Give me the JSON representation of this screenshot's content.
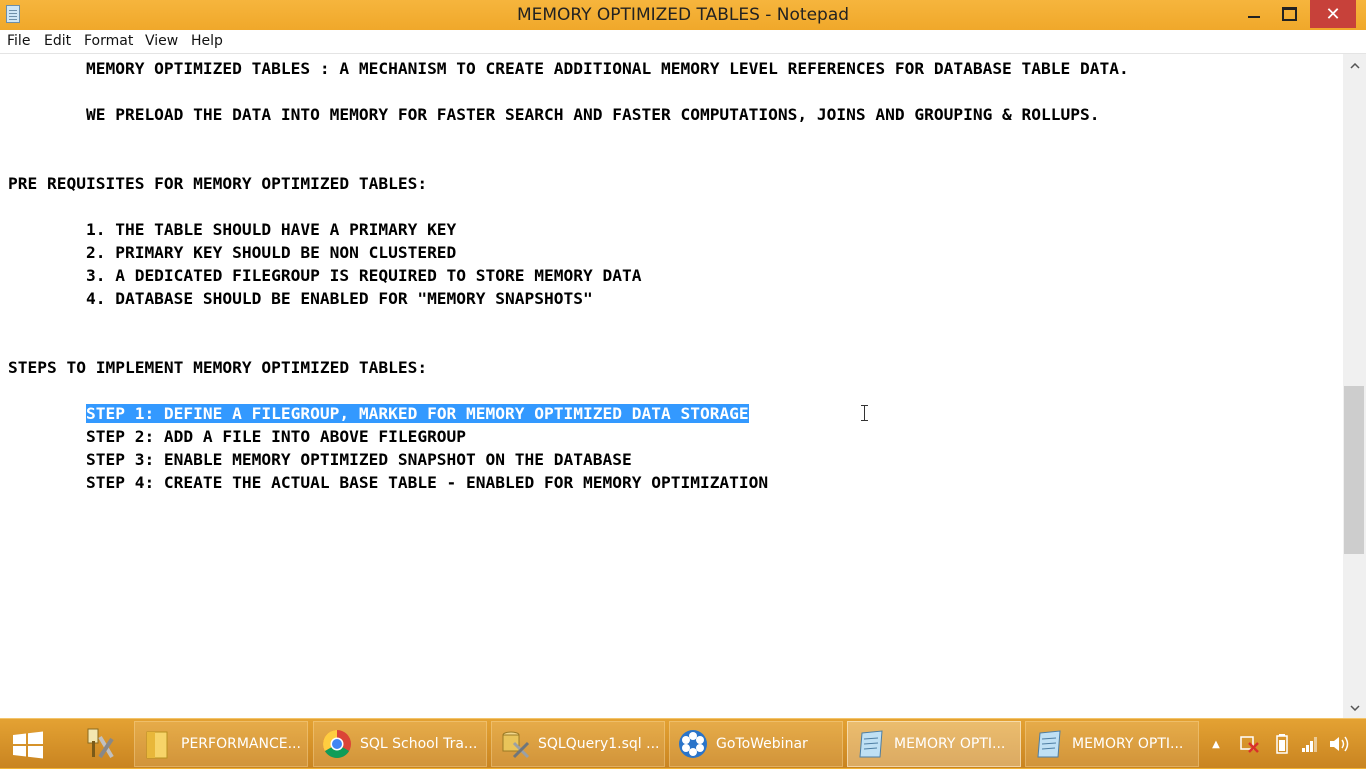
{
  "window": {
    "title": "MEMORY OPTIMIZED TABLES - Notepad",
    "close_glyph": "✕"
  },
  "menu": {
    "file": "File",
    "edit": "Edit",
    "format": "Format",
    "view": "View",
    "help": "Help"
  },
  "document": {
    "line1": "        MEMORY OPTIMIZED TABLES : A MECHANISM TO CREATE ADDITIONAL MEMORY LEVEL REFERENCES FOR DATABASE TABLE DATA.",
    "line2": "        WE PRELOAD THE DATA INTO MEMORY FOR FASTER SEARCH AND FASTER COMPUTATIONS, JOINS AND GROUPING & ROLLUPS.",
    "prereq_heading": "PRE REQUISITES FOR MEMORY OPTIMIZED TABLES:",
    "prereqs": [
      "        1. THE TABLE SHOULD HAVE A PRIMARY KEY",
      "        2. PRIMARY KEY SHOULD BE NON CLUSTERED",
      "        3. A DEDICATED FILEGROUP IS REQUIRED TO STORE MEMORY DATA",
      "        4. DATABASE SHOULD BE ENABLED FOR \"MEMORY SNAPSHOTS\""
    ],
    "steps_heading": "STEPS TO IMPLEMENT MEMORY OPTIMIZED TABLES:",
    "steps_indent": "        ",
    "steps": [
      "STEP 1: DEFINE A FILEGROUP, MARKED FOR MEMORY OPTIMIZED DATA STORAGE",
      "        STEP 2: ADD A FILE INTO ABOVE FILEGROUP",
      "        STEP 3: ENABLE MEMORY OPTIMIZED SNAPSHOT ON THE DATABASE",
      "        STEP 4: CREATE THE ACTUAL BASE TABLE - ENABLED FOR MEMORY OPTIMIZATION"
    ]
  },
  "taskbar": {
    "items": [
      {
        "label": "PERFORMANCE...",
        "icon": "folder-icon"
      },
      {
        "label": "SQL School Tra...",
        "icon": "chrome-icon"
      },
      {
        "label": "SQLQuery1.sql ...",
        "icon": "ssms-icon"
      },
      {
        "label": "GoToWebinar",
        "icon": "gotowebinar-icon"
      },
      {
        "label": "MEMORY OPTI...",
        "icon": "notepad-icon"
      },
      {
        "label": "MEMORY OPTI...",
        "icon": "notepad-icon"
      }
    ],
    "tray": {
      "show_hidden_glyph": "▲"
    }
  },
  "colors": {
    "accent": "#f0a82a",
    "selection": "#3399ff",
    "close_button": "#c7413a"
  }
}
